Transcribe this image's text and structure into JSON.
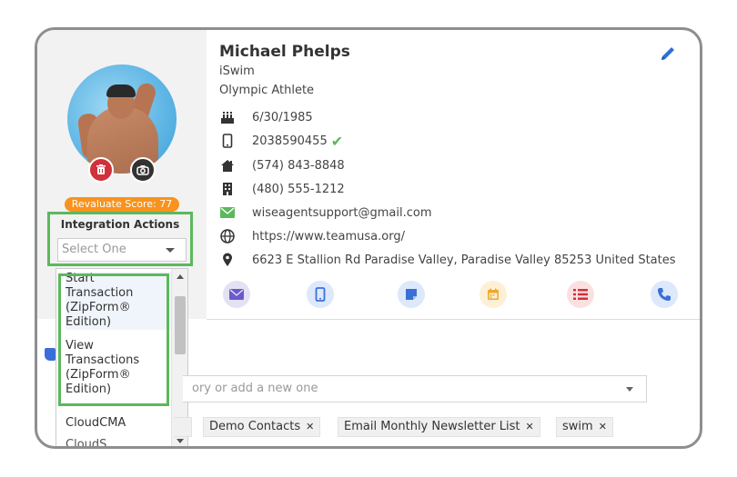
{
  "contact": {
    "name": "Michael Phelps",
    "company": "iSwim",
    "job_title": "Olympic Athlete",
    "birthday": "6/30/1985",
    "mobile": "2038590455",
    "home_phone": "(574) 843-8848",
    "work_phone": "(480) 555-1212",
    "email": "wiseagentsupport@gmail.com",
    "website": "https://www.teamusa.org/",
    "address": "6623 E Stallion Rd Paradise Valley, Paradise Valley 85253 United States"
  },
  "score_badge": "Revaluate Score: 77",
  "integration": {
    "title": "Integration Actions",
    "placeholder": "Select One",
    "options": [
      {
        "line1": "Start",
        "line2": "Transaction",
        "line3": "(ZipForm®",
        "line4": "Edition)"
      },
      {
        "line1": "View",
        "line2": "Transactions",
        "line3": "(ZipForm®",
        "line4": "Edition)"
      },
      {
        "line1": "CloudCMA"
      },
      {
        "line1": "CloudS..."
      }
    ]
  },
  "categories": {
    "placeholder": "ory or add a new one",
    "tags": [
      "Demo Contacts",
      "Email Monthly Newsletter List",
      "swim"
    ]
  },
  "colors": {
    "green_highlight": "#5cb85c",
    "score_orange": "#f7931e",
    "delete_red": "#d0313a",
    "accent_blue": "#3a6fd8"
  }
}
